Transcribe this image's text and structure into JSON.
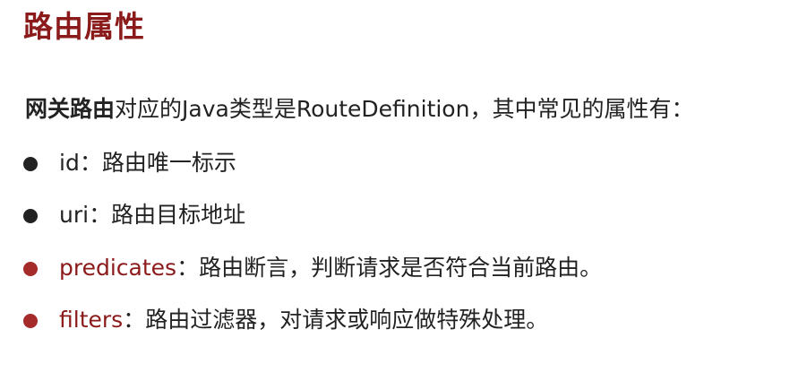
{
  "title": "路由属性",
  "intro": {
    "bold": "网关路由",
    "rest": "对应的Java类型是RouteDefinition，其中常见的属性有："
  },
  "colors": {
    "title": "#8b1a1a",
    "accent": "#a52a2a",
    "text": "#222222"
  },
  "items": [
    {
      "term": "id",
      "desc": "：路由唯一标示",
      "highlight": false
    },
    {
      "term": "uri",
      "desc": "：路由目标地址",
      "highlight": false
    },
    {
      "term": "predicates",
      "desc": "：路由断言，判断请求是否符合当前路由。",
      "highlight": true
    },
    {
      "term": "filters",
      "desc": "：路由过滤器，对请求或响应做特殊处理。",
      "highlight": true
    }
  ]
}
